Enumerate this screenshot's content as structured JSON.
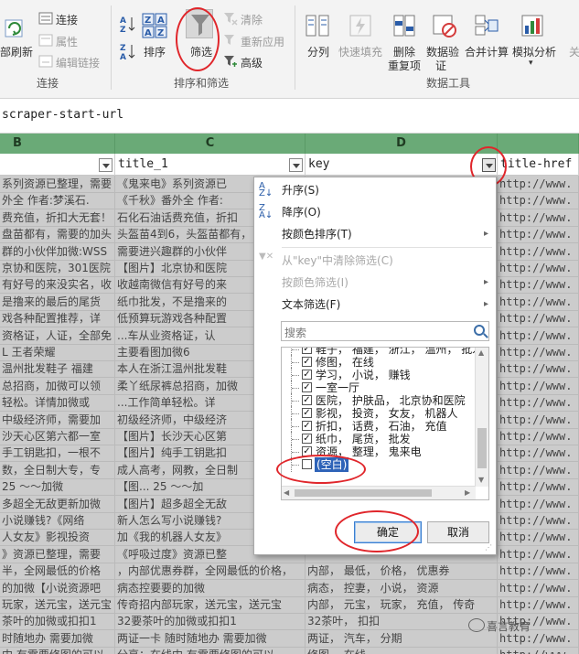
{
  "ribbon": {
    "connections_group": {
      "refresh_label": "部刷新",
      "connections_label": "连接",
      "properties_label": "属性",
      "edit_links_label": "编辑链接",
      "group_label": "连接"
    },
    "sort_filter_group": {
      "sort_label": "排序",
      "filter_label": "筛选",
      "clear_label": "清除",
      "reapply_label": "重新应用",
      "advanced_label": "高级",
      "group_label": "排序和筛选"
    },
    "data_tools_group": {
      "text_to_columns_label": "分列",
      "flash_fill_label": "快速填充",
      "remove_duplicates_label_1": "删除",
      "remove_duplicates_label_2": "重复项",
      "data_validation_label_1": "数据验",
      "data_validation_label_2": "证",
      "consolidate_label": "合并计算",
      "what_if_label": "模拟分析",
      "relationships_label": "关",
      "group_label": "数据工具"
    }
  },
  "formula_bar": {
    "content": "scraper-start-url"
  },
  "column_letters": [
    "B",
    "C",
    "D"
  ],
  "header_row": {
    "b": "",
    "c": "title_1",
    "d": "key",
    "e": "title-href"
  },
  "rows": [
    {
      "b": "系列资源已整理，需要",
      "c": "《鬼来电》系列资源已",
      "d": "",
      "e": "http://www."
    },
    {
      "b": "外全  作者:梦溪石.",
      "c": "《千秋》番外全  作者:",
      "d": "",
      "e": "http://www."
    },
    {
      "b": "费充值，折扣大无套！",
      "c": "石化石油话费充值，折扣",
      "d": "",
      "e": "http://www."
    },
    {
      "b": "盘苗都有，需要的加头",
      "c": "头盔苗4到6，头盔苗都有，",
      "d": "",
      "e": "http://www."
    },
    {
      "b": "群的小伙伴加微:WSS",
      "c": "需要进兴趣群的小伙伴",
      "d": "",
      "e": "http://www."
    },
    {
      "b": "京协和医院，301医院",
      "c": "【图片】北京协和医院",
      "d": "",
      "e": "http://www."
    },
    {
      "b": "有好号的来没实名，收",
      "c": "收越南微信有好号的来",
      "d": "",
      "e": "http://www."
    },
    {
      "b": "是撸来的最后的尾货",
      "c": "纸巾批发，不是撸来的",
      "d": "",
      "e": "http://www."
    },
    {
      "b": "戏各种配置推荐，详",
      "c": "低预算玩游戏各种配置",
      "d": "",
      "e": "http://www."
    },
    {
      "b": "资格证，人证，全部免",
      "c": "...车从业资格证，认",
      "d": "",
      "e": "http://www."
    },
    {
      "b": "L     王者荣耀",
      "c": "主要看图加微6",
      "d": "",
      "e": "http://www."
    },
    {
      "b": "温州批发鞋子  福建",
      "c": "本人在浙江温州批发鞋",
      "d": "",
      "e": "http://www."
    },
    {
      "b": "总招商，加微可以领",
      "c": "柔丫纸尿裤总招商，加微",
      "d": "",
      "e": "http://www."
    },
    {
      "b": "轻松。详情加微或",
      "c": "...工作简单轻松。详",
      "d": "",
      "e": "http://www."
    },
    {
      "b": "中级经济师，需要加",
      "c": "初级经济师，中级经济",
      "d": "",
      "e": "http://www."
    },
    {
      "b": "沙天心区第六都一室",
      "c": "【图片】长沙天心区第",
      "d": "",
      "e": "http://www."
    },
    {
      "b": "手工钥匙扣，一根不",
      "c": "【图片】纯手工钥匙扣",
      "d": "",
      "e": "http://www."
    },
    {
      "b": "数，全日制大专，专",
      "c": "成人高考，网教，全日制",
      "d": "",
      "e": "http://www."
    },
    {
      "b": "25  ～～加微",
      "c": "【图...    25  ～～加",
      "d": "",
      "e": "http://www."
    },
    {
      "b": "多超全无敌更新加微",
      "c": "【图片】超多超全无敌",
      "d": "",
      "e": "http://www."
    },
    {
      "b": "小说赚钱?《网络",
      "c": "新人怎么写小说赚钱?",
      "d": "",
      "e": "http://www."
    },
    {
      "b": "人女友》影视投资",
      "c": "加《我的机器人女友》",
      "d": "",
      "e": "http://www."
    },
    {
      "b": "》资源已整理，需要",
      "c": "《呼吸过度》资源已整",
      "d": "",
      "e": "http://www."
    },
    {
      "b": "半，全网最低的价格",
      "c": "，内部优惠券群，全网最低的价格，",
      "d": "内部，  最低，  价格，  优惠券",
      "e": "http://www."
    },
    {
      "b": "的加微【小说资源吧",
      "c": "病态控要要的加微",
      "d": "病态，  控妻，  小说，  资源",
      "e": "http://www."
    },
    {
      "b": "玩家，送元宝，送元宝",
      "c": "传奇招内部玩家，送元宝，送元宝",
      "d": "内部，  元宝，  玩家，  充值，  传奇",
      "e": "http://www."
    },
    {
      "b": "茶叶的加微或扣扣1",
      "c": "32要茶叶的加微或扣扣1",
      "d": "32茶叶，  扣扣",
      "e": "http://www."
    },
    {
      "b": "时随地办  需要加微",
      "c": "两证一卡  随时随地办  需要加微",
      "d": "两证，  汽车，  分期",
      "e": "http://www."
    },
    {
      "b": "中  有需要修图的可以",
      "c": "分享：在线中  有需要修图的可以",
      "d": "修图，  在线",
      "e": "http://www."
    }
  ],
  "filter_menu": {
    "sort_asc": "升序(S)",
    "sort_desc": "降序(O)",
    "sort_by_color": "按颜色排序(T)",
    "clear_filter": "从\"key\"中清除筛选(C)",
    "filter_by_color": "按颜色筛选(I)",
    "text_filters": "文本筛选(F)",
    "search_placeholder": "搜索",
    "items": [
      {
        "label": "鞋子，  福建，  浙江，  温州，  批发",
        "checked": true
      },
      {
        "label": "修图，  在线",
        "checked": true
      },
      {
        "label": "学习，  小说，  赚钱",
        "checked": true
      },
      {
        "label": "一室一厅",
        "checked": true
      },
      {
        "label": "医院，  护肤品，  北京协和医院",
        "checked": true
      },
      {
        "label": "影视，  投资，  女友，  机器人",
        "checked": true
      },
      {
        "label": "折扣，  话费，  石油，  充值",
        "checked": true
      },
      {
        "label": "纸巾，  尾货，  批发",
        "checked": true
      },
      {
        "label": "资源，  整理，  鬼来电",
        "checked": true
      },
      {
        "label": "(空白)",
        "checked": false
      }
    ],
    "ok_label": "确定",
    "cancel_label": "取消"
  },
  "watermark": "喜言教育"
}
